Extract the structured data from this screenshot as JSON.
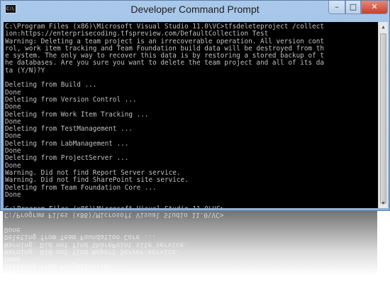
{
  "window": {
    "title": "Developer Command Prompt",
    "icon": "cmd-icon",
    "icon_text": "C:\\",
    "controls": {
      "minimize": "–",
      "maximize": "□",
      "close": "✕"
    }
  },
  "console": {
    "lines": [
      "C:\\Program Files (x86)\\Microsoft Visual Studio 11.0\\VC>tfsdeleteproject /collect",
      "ion:https://enterprisecoding.tfspreview.com/DefaultCollection Test",
      "Warning: Deleting a team project is an irrecoverable operation. All version cont",
      "rol, work item tracking and Team Foundation build data will be destroyed from th",
      "e system. The only way to recover this data is by restoring a stored backup of t",
      "he databases. Are you sure you want to delete the team project and all of its da",
      "ta (Y/N)?Y",
      "",
      "Deleting from Build ...",
      "Done",
      "Deleting from Version Control ...",
      "Done",
      "Deleting from Work Item Tracking ...",
      "Done",
      "Deleting from TestManagement ...",
      "Done",
      "Deleting from LabManagement ...",
      "Done",
      "Deleting from ProjectServer ...",
      "Done",
      "Warning. Did not find Report Server service.",
      "Warning. Did not find SharePoint site service.",
      "Deleting from Team Foundation Core ...",
      "Done",
      "",
      "C:\\Program Files (x86)\\Microsoft Visual Studio 11.0\\VC>"
    ]
  },
  "colors": {
    "console_bg": "#000000",
    "console_fg": "#c0c0c0",
    "titlebar": "#a9c8ea",
    "close_button": "#c7402c"
  }
}
